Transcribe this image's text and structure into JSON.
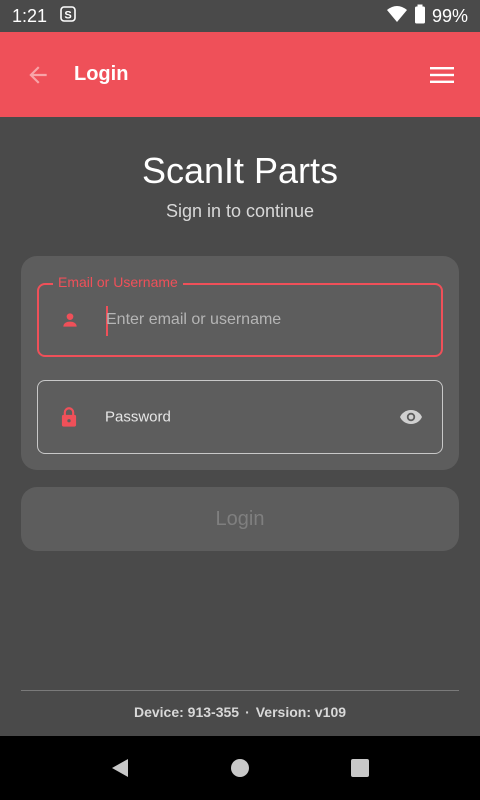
{
  "status_bar": {
    "time": "1:21",
    "notification_icon": "s-icon",
    "battery": "99%"
  },
  "app_bar": {
    "title": "Login",
    "back_icon": "arrow-back-icon",
    "menu_icon": "hamburger-menu-icon",
    "accent_color": "#ef5059"
  },
  "brand": {
    "title": "ScanIt Parts",
    "subtitle": "Sign in to continue"
  },
  "form": {
    "email": {
      "label": "Email or Username",
      "placeholder": "Enter email or username",
      "value": ""
    },
    "password": {
      "label": "Password",
      "value": ""
    },
    "login_label": "Login"
  },
  "footer": {
    "device": "Device: 913-355",
    "separator": "·",
    "version": "Version: v109"
  }
}
